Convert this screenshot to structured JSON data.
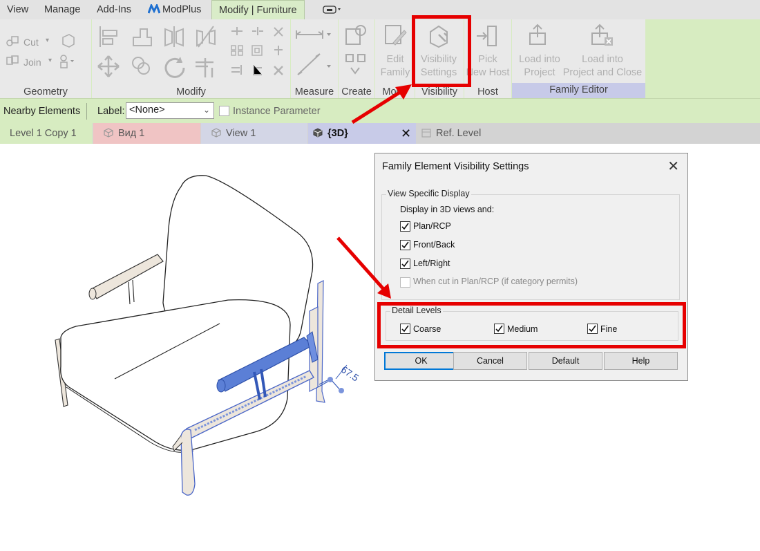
{
  "menubar": {
    "tabs": [
      {
        "label": "View"
      },
      {
        "label": "Manage"
      },
      {
        "label": "Add-Ins"
      },
      {
        "label": "ModPlus"
      },
      {
        "label": "Modify | Furniture"
      }
    ]
  },
  "ribbon": {
    "geometry": {
      "title": "Geometry",
      "cut_label": "Cut",
      "join_label": "Join"
    },
    "modify": {
      "title": "Modify"
    },
    "measure": {
      "title": "Measure"
    },
    "create": {
      "title": "Create"
    },
    "mode": {
      "title": "Mode",
      "edit_family_label": "Edit\nFamily"
    },
    "visibility": {
      "title": "Visibility",
      "settings_label": "Visibility\nSettings"
    },
    "host": {
      "title": "Host",
      "pick_new_host_label": "Pick\nNew Host"
    },
    "family_editor": {
      "title": "Family Editor",
      "load_into_project_label": "Load into\nProject",
      "load_into_project_close_label": "Load into\nProject and Close"
    }
  },
  "optionsbar": {
    "nearby_elements": "Nearby Elements",
    "label_caption": "Label:",
    "label_value": "<None>",
    "instance_parameter": "Instance Parameter"
  },
  "viewtabs": [
    {
      "label": "Level 1 Copy 1",
      "color": "#d7ecc1"
    },
    {
      "label": "Вид 1",
      "color": "#f0c4c4"
    },
    {
      "label": "View 1",
      "color": "#d3d6e6"
    },
    {
      "label": "{3D}",
      "color": "#c8cbe8",
      "active": true
    },
    {
      "label": "Ref. Level",
      "color": "#d3d3d3"
    }
  ],
  "dimension": {
    "value": "67.5"
  },
  "dialog": {
    "title": "Family Element Visibility Settings",
    "view_specific": {
      "title": "View Specific Display",
      "display_in_3d": "Display in 3D views and:",
      "options": [
        {
          "label": "Plan/RCP",
          "checked": true
        },
        {
          "label": "Front/Back",
          "checked": true
        },
        {
          "label": "Left/Right",
          "checked": true
        },
        {
          "label": "When cut in Plan/RCP (if category permits)",
          "checked": false,
          "disabled": true
        }
      ]
    },
    "detail_levels": {
      "title": "Detail Levels",
      "options": [
        {
          "label": "Coarse",
          "checked": true
        },
        {
          "label": "Medium",
          "checked": true
        },
        {
          "label": "Fine",
          "checked": true
        }
      ]
    },
    "buttons": {
      "ok": "OK",
      "cancel": "Cancel",
      "default": "Default",
      "help": "Help"
    }
  },
  "colors": {
    "highlight_red": "#e60000",
    "selection_blue": "#5b7fd6",
    "ribbon_green": "#d7ecc1"
  }
}
